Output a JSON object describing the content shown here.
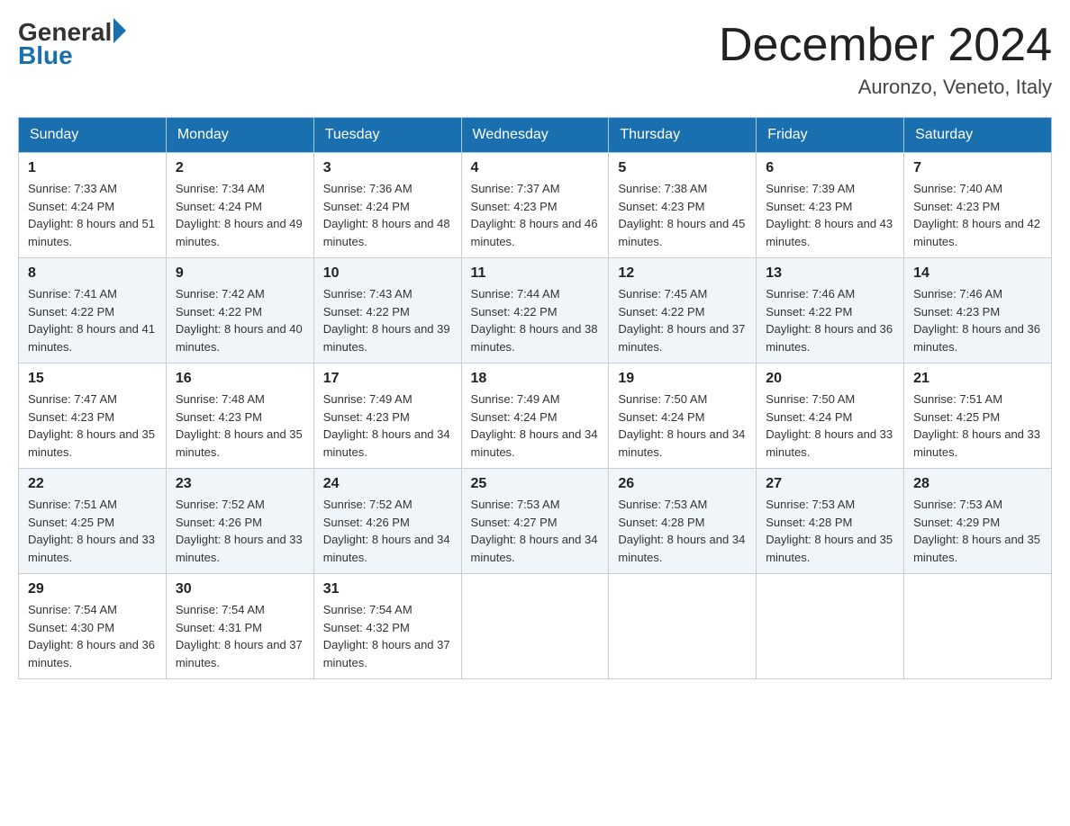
{
  "header": {
    "logo_text_general": "General",
    "logo_text_blue": "Blue",
    "month_title": "December 2024",
    "location": "Auronzo, Veneto, Italy"
  },
  "days_of_week": [
    "Sunday",
    "Monday",
    "Tuesday",
    "Wednesday",
    "Thursday",
    "Friday",
    "Saturday"
  ],
  "weeks": [
    [
      {
        "date": "1",
        "sunrise": "7:33 AM",
        "sunset": "4:24 PM",
        "daylight": "8 hours and 51 minutes."
      },
      {
        "date": "2",
        "sunrise": "7:34 AM",
        "sunset": "4:24 PM",
        "daylight": "8 hours and 49 minutes."
      },
      {
        "date": "3",
        "sunrise": "7:36 AM",
        "sunset": "4:24 PM",
        "daylight": "8 hours and 48 minutes."
      },
      {
        "date": "4",
        "sunrise": "7:37 AM",
        "sunset": "4:23 PM",
        "daylight": "8 hours and 46 minutes."
      },
      {
        "date": "5",
        "sunrise": "7:38 AM",
        "sunset": "4:23 PM",
        "daylight": "8 hours and 45 minutes."
      },
      {
        "date": "6",
        "sunrise": "7:39 AM",
        "sunset": "4:23 PM",
        "daylight": "8 hours and 43 minutes."
      },
      {
        "date": "7",
        "sunrise": "7:40 AM",
        "sunset": "4:23 PM",
        "daylight": "8 hours and 42 minutes."
      }
    ],
    [
      {
        "date": "8",
        "sunrise": "7:41 AM",
        "sunset": "4:22 PM",
        "daylight": "8 hours and 41 minutes."
      },
      {
        "date": "9",
        "sunrise": "7:42 AM",
        "sunset": "4:22 PM",
        "daylight": "8 hours and 40 minutes."
      },
      {
        "date": "10",
        "sunrise": "7:43 AM",
        "sunset": "4:22 PM",
        "daylight": "8 hours and 39 minutes."
      },
      {
        "date": "11",
        "sunrise": "7:44 AM",
        "sunset": "4:22 PM",
        "daylight": "8 hours and 38 minutes."
      },
      {
        "date": "12",
        "sunrise": "7:45 AM",
        "sunset": "4:22 PM",
        "daylight": "8 hours and 37 minutes."
      },
      {
        "date": "13",
        "sunrise": "7:46 AM",
        "sunset": "4:22 PM",
        "daylight": "8 hours and 36 minutes."
      },
      {
        "date": "14",
        "sunrise": "7:46 AM",
        "sunset": "4:23 PM",
        "daylight": "8 hours and 36 minutes."
      }
    ],
    [
      {
        "date": "15",
        "sunrise": "7:47 AM",
        "sunset": "4:23 PM",
        "daylight": "8 hours and 35 minutes."
      },
      {
        "date": "16",
        "sunrise": "7:48 AM",
        "sunset": "4:23 PM",
        "daylight": "8 hours and 35 minutes."
      },
      {
        "date": "17",
        "sunrise": "7:49 AM",
        "sunset": "4:23 PM",
        "daylight": "8 hours and 34 minutes."
      },
      {
        "date": "18",
        "sunrise": "7:49 AM",
        "sunset": "4:24 PM",
        "daylight": "8 hours and 34 minutes."
      },
      {
        "date": "19",
        "sunrise": "7:50 AM",
        "sunset": "4:24 PM",
        "daylight": "8 hours and 34 minutes."
      },
      {
        "date": "20",
        "sunrise": "7:50 AM",
        "sunset": "4:24 PM",
        "daylight": "8 hours and 33 minutes."
      },
      {
        "date": "21",
        "sunrise": "7:51 AM",
        "sunset": "4:25 PM",
        "daylight": "8 hours and 33 minutes."
      }
    ],
    [
      {
        "date": "22",
        "sunrise": "7:51 AM",
        "sunset": "4:25 PM",
        "daylight": "8 hours and 33 minutes."
      },
      {
        "date": "23",
        "sunrise": "7:52 AM",
        "sunset": "4:26 PM",
        "daylight": "8 hours and 33 minutes."
      },
      {
        "date": "24",
        "sunrise": "7:52 AM",
        "sunset": "4:26 PM",
        "daylight": "8 hours and 34 minutes."
      },
      {
        "date": "25",
        "sunrise": "7:53 AM",
        "sunset": "4:27 PM",
        "daylight": "8 hours and 34 minutes."
      },
      {
        "date": "26",
        "sunrise": "7:53 AM",
        "sunset": "4:28 PM",
        "daylight": "8 hours and 34 minutes."
      },
      {
        "date": "27",
        "sunrise": "7:53 AM",
        "sunset": "4:28 PM",
        "daylight": "8 hours and 35 minutes."
      },
      {
        "date": "28",
        "sunrise": "7:53 AM",
        "sunset": "4:29 PM",
        "daylight": "8 hours and 35 minutes."
      }
    ],
    [
      {
        "date": "29",
        "sunrise": "7:54 AM",
        "sunset": "4:30 PM",
        "daylight": "8 hours and 36 minutes."
      },
      {
        "date": "30",
        "sunrise": "7:54 AM",
        "sunset": "4:31 PM",
        "daylight": "8 hours and 37 minutes."
      },
      {
        "date": "31",
        "sunrise": "7:54 AM",
        "sunset": "4:32 PM",
        "daylight": "8 hours and 37 minutes."
      },
      null,
      null,
      null,
      null
    ]
  ]
}
